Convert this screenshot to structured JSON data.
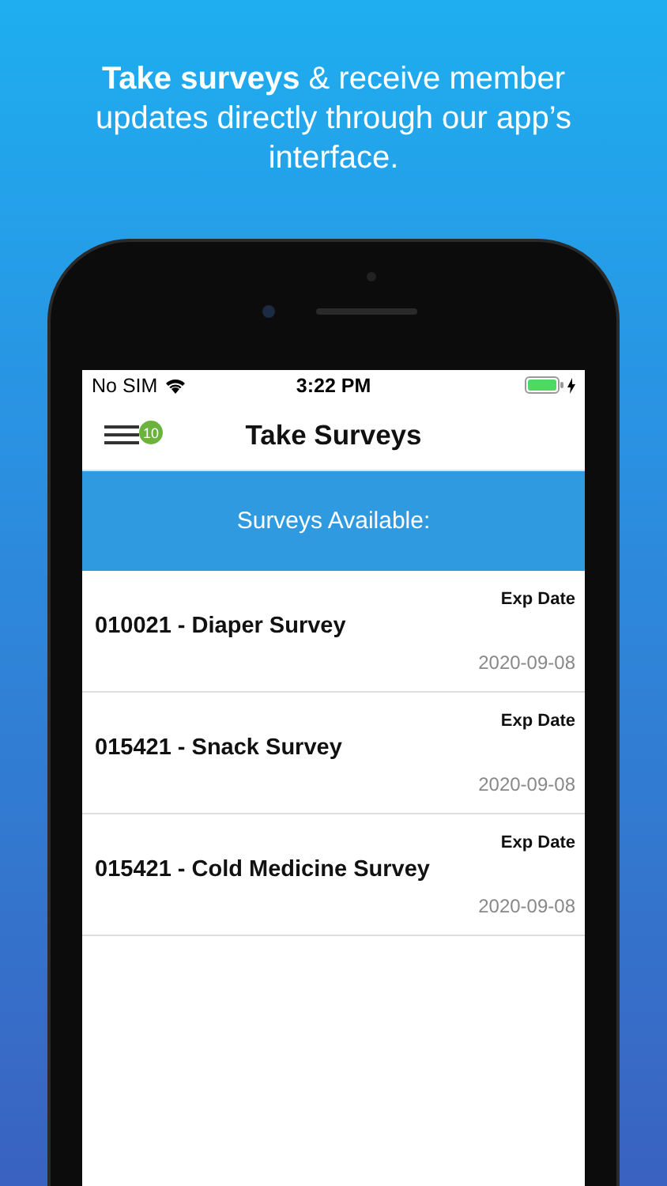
{
  "headline": "**Take surveys** & receive member updates directly through our app’s interface.",
  "status_bar": {
    "carrier": "No SIM",
    "time": "3:22 PM",
    "charging": true
  },
  "nav": {
    "title": "Take Surveys",
    "badge": "10"
  },
  "banner": "Surveys Available:",
  "surveys": [
    {
      "name": "010021 - Diaper Survey",
      "date_label": "Exp Date",
      "date": "2020-09-08"
    },
    {
      "name": "015421 - Snack Survey",
      "date_label": "Exp Date",
      "date": "2020-09-08"
    },
    {
      "name": "015421 - Cold Medicine Survey",
      "date_label": "Exp Date",
      "date": "2020-09-08"
    }
  ]
}
